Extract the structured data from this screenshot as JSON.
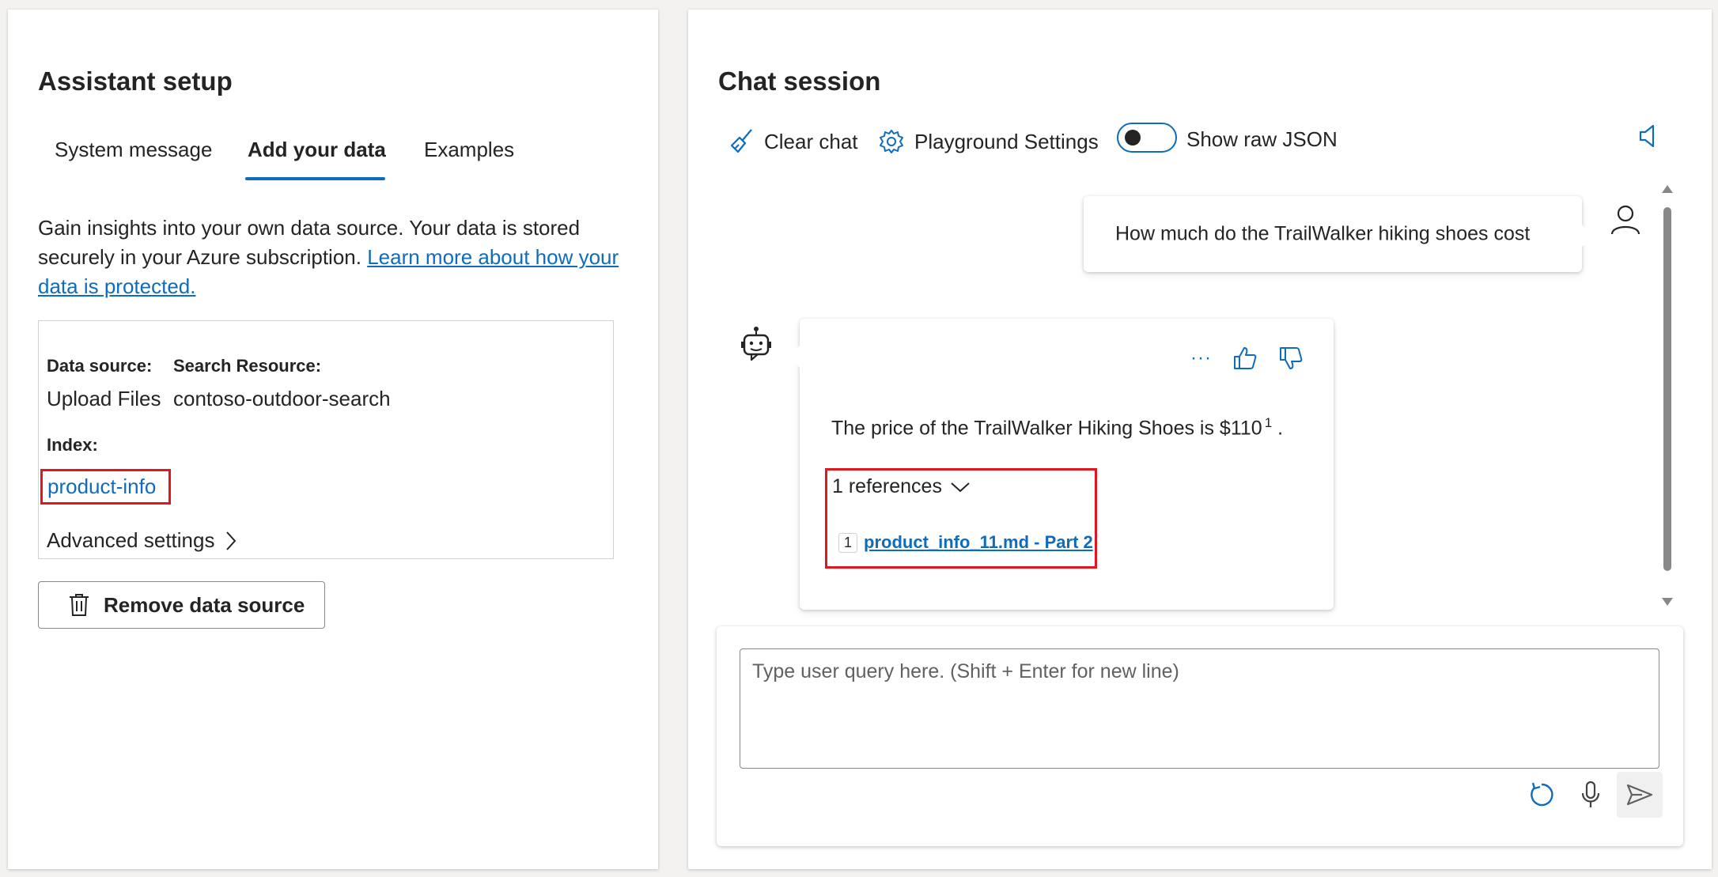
{
  "left": {
    "title": "Assistant setup",
    "tabs": [
      {
        "label": "System message"
      },
      {
        "label": "Add your data"
      },
      {
        "label": "Examples"
      }
    ],
    "description": "Gain insights into your own data source. Your data is stored securely in your Azure subscription. ",
    "learn_more_link": "Learn more about how your data is protected.",
    "data_source_label": "Data source:",
    "data_source_value": "Upload Files",
    "search_resource_label": "Search Resource:",
    "search_resource_value": "contoso-outdoor-search",
    "index_label": "Index:",
    "index_value": "product-info",
    "advanced_settings": "Advanced settings",
    "remove_button": "Remove data source"
  },
  "right": {
    "title": "Chat session",
    "clear_chat": "Clear chat",
    "playground_settings": "Playground Settings",
    "show_raw_json": "Show raw JSON",
    "toggle_on": false,
    "user_message": "How much do the TrailWalker hiking shoes cost",
    "assistant_answer": "The price of the TrailWalker Hiking Shoes is $110",
    "citation_marker": "1",
    "answer_end": ".",
    "more_actions": "···",
    "references_toggle": "1 references",
    "references": [
      {
        "num": "1",
        "label": "product_info_11.md - Part 2"
      }
    ],
    "query_placeholder": "Type user query here. (Shift + Enter for new line)"
  },
  "colors": {
    "accent": "#0f6cbd",
    "highlight": "#e3161f"
  }
}
